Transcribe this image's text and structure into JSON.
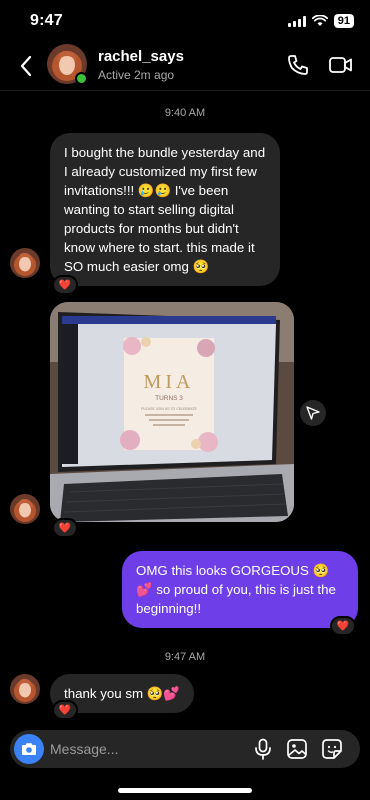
{
  "status_bar": {
    "time": "9:47",
    "battery": "91"
  },
  "contact": {
    "username": "rachel_says",
    "status": "Active 2m ago"
  },
  "messages": {
    "timestamp1": "9:40 AM",
    "incoming1": "I bought the bundle yesterday and I already customized my first few invitations!!! 🥲🥲 I've been wanting to start selling digital products for months but didn't know where to start. this made it SO much easier omg 🥺",
    "photo": {
      "invite_name": "MIA",
      "invite_line": "TURNS 3",
      "invite_details": "PLEASE JOIN US TO CELEBRATE"
    },
    "outgoing1": "OMG this looks GORGEOUS 🥺💕 so proud of you, this is just the beginning!!",
    "timestamp2": "9:47 AM",
    "incoming2": "thank you sm 🥺💕"
  },
  "reactions": {
    "heart": "❤️"
  },
  "composer": {
    "placeholder": "Message..."
  },
  "colors": {
    "outgoing_bubble": "#6e3fe8",
    "incoming_bubble": "#262626",
    "camera_button": "#3b82f6",
    "online": "#3cc13b"
  }
}
